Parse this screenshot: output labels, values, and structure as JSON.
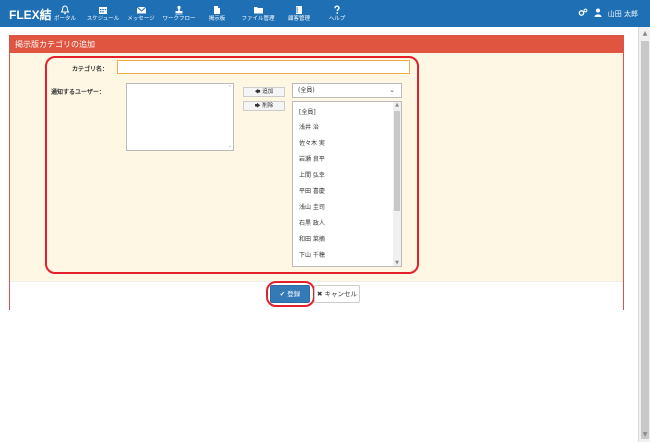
{
  "header": {
    "logo": "FLEX結",
    "nav": [
      {
        "label": "ポータル",
        "icon": "bell-icon"
      },
      {
        "label": "スケジュール",
        "icon": "calendar-icon"
      },
      {
        "label": "メッセージ",
        "icon": "envelope-icon"
      },
      {
        "label": "ワークフロー",
        "icon": "stamp-icon"
      },
      {
        "label": "掲示板",
        "icon": "document-icon"
      },
      {
        "label": "ファイル管理",
        "icon": "folder-icon"
      },
      {
        "label": "顧客管理",
        "icon": "notebook-icon"
      },
      {
        "label": "ヘルプ",
        "icon": "question-icon"
      }
    ],
    "user": {
      "name": "山田 太郎",
      "settings_icon": "gears-icon"
    }
  },
  "panel": {
    "title": "掲示版カテゴリの追加",
    "category_label": "カテゴリ名：",
    "category_value": "",
    "notify_label": "通知するユーザー：",
    "add_button": "追加",
    "remove_button": "削除",
    "group_select": "(全員)",
    "users": [
      "[全員]",
      "浅井 治",
      "佐々木 実",
      "岩瀬 良平",
      "上間 弘幸",
      "平田 喜慶",
      "浅山 圭司",
      "石黒 政人",
      "和田 菜摘",
      "下山 千穂"
    ]
  },
  "footer": {
    "register_button": "登録",
    "cancel_button": "キャンセル"
  },
  "colors": {
    "header_bg": "#1e6fb4",
    "panel_header": "#e0553f",
    "panel_body": "#fdf7e4",
    "highlight": "#e3202b",
    "primary_button": "#337ab7"
  }
}
